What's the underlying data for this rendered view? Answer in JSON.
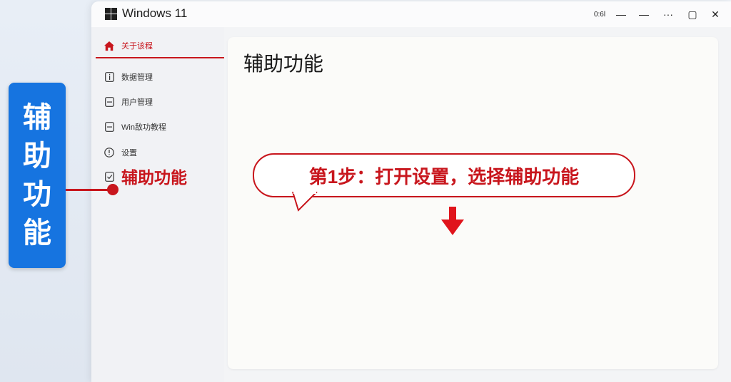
{
  "window": {
    "title": "Windows 11",
    "controls": {
      "status": "0:6l",
      "minimize": "—",
      "separator": "—",
      "more": "···",
      "maximize": "▢",
      "close": "✕"
    }
  },
  "sidebar": {
    "items": [
      {
        "label": "关于该程",
        "icon": "home-icon",
        "active": true
      },
      {
        "label": "数据管理",
        "icon": "info-icon"
      },
      {
        "label": "用户管理",
        "icon": "minus-box-icon"
      },
      {
        "label": "Win敌功教程",
        "icon": "minus-box-icon"
      },
      {
        "label": "设置",
        "icon": "alert-circle-icon"
      },
      {
        "label": "",
        "icon": "check-box-icon"
      }
    ]
  },
  "main": {
    "title": "辅助功能"
  },
  "annotations": {
    "side_label": [
      "辅",
      "助",
      "功",
      "能"
    ],
    "pointer_label": "辅助功能",
    "callout": "第1步：打开设置，选择辅助功能"
  },
  "colors": {
    "accent_red": "#c8161d",
    "label_blue": "#1674e0"
  }
}
